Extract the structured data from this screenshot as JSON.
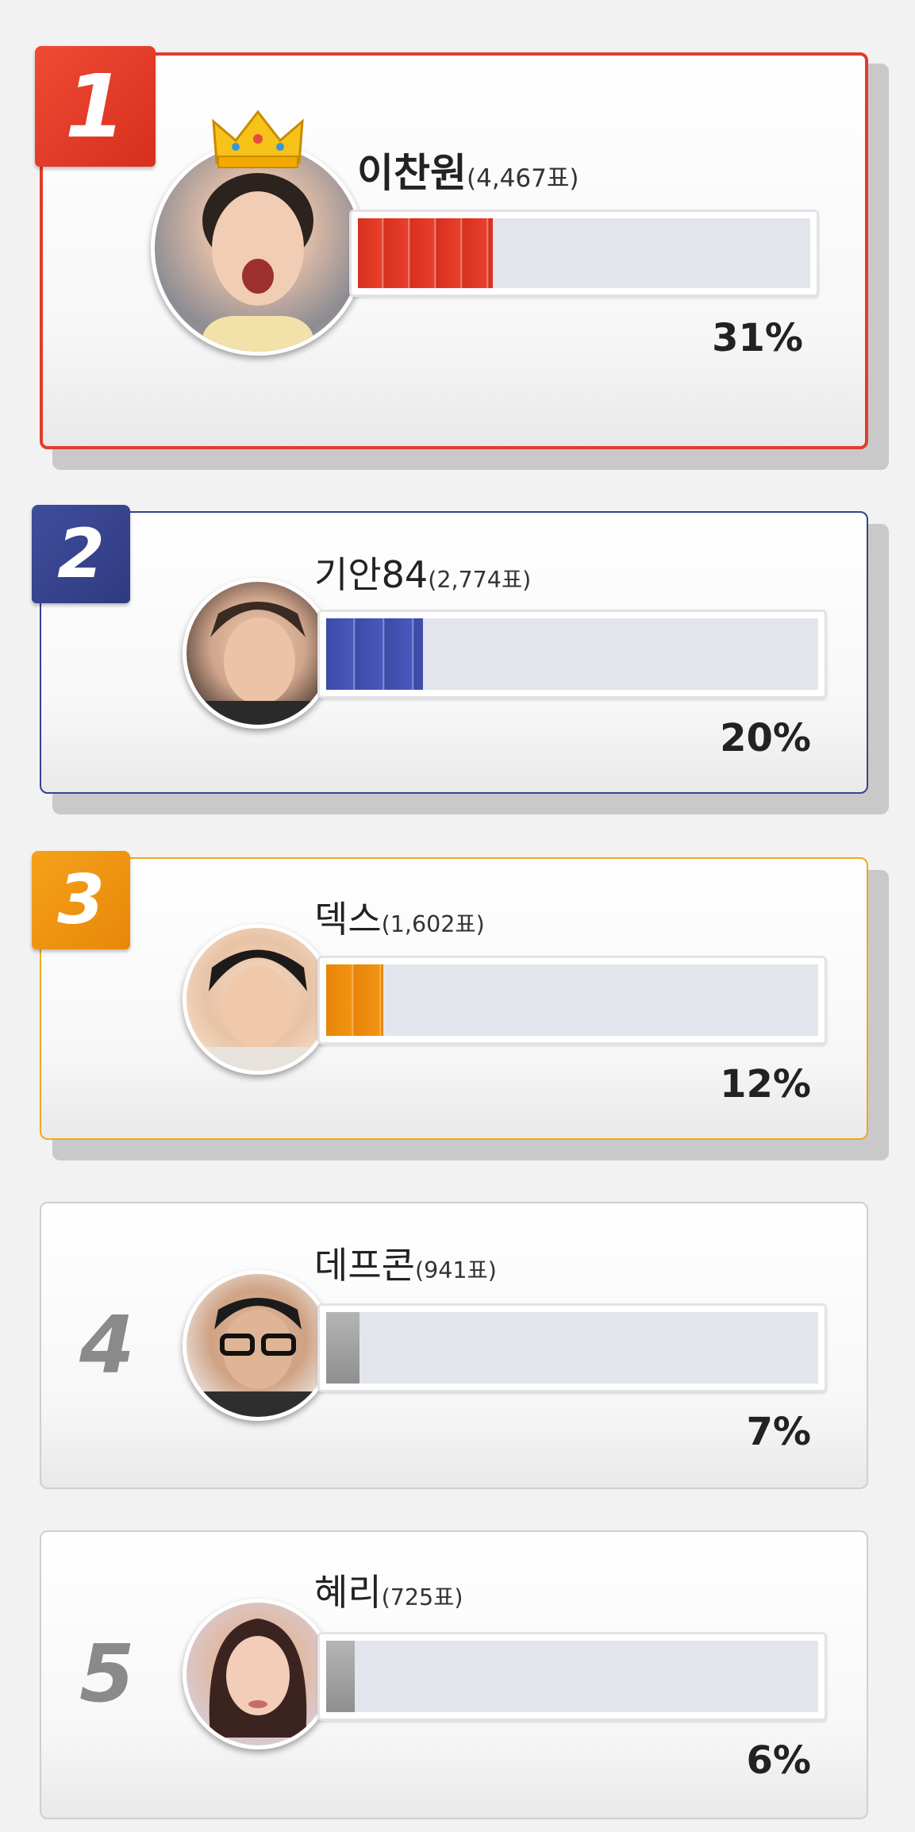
{
  "rankings": [
    {
      "rank": "1",
      "name": "이찬원",
      "votes": "(4,467표)",
      "percent": "31%",
      "percent_value": 31,
      "accent": "#e23c2a",
      "avatar": "person-photo"
    },
    {
      "rank": "2",
      "name": "기안84",
      "votes": "(2,774표)",
      "percent": "20%",
      "percent_value": 20,
      "accent": "#36428f",
      "avatar": "person-photo"
    },
    {
      "rank": "3",
      "name": "덱스",
      "votes": "(1,602표)",
      "percent": "12%",
      "percent_value": 12,
      "accent": "#f0940c",
      "avatar": "person-photo"
    },
    {
      "rank": "4",
      "name": "데프콘",
      "votes": "(941표)",
      "percent": "7%",
      "percent_value": 7,
      "accent": "#9a9a9a",
      "avatar": "person-photo"
    },
    {
      "rank": "5",
      "name": "혜리",
      "votes": "(725표)",
      "percent": "6%",
      "percent_value": 6,
      "accent": "#9a9a9a",
      "avatar": "person-photo"
    }
  ],
  "crown_icon": "crown-icon"
}
